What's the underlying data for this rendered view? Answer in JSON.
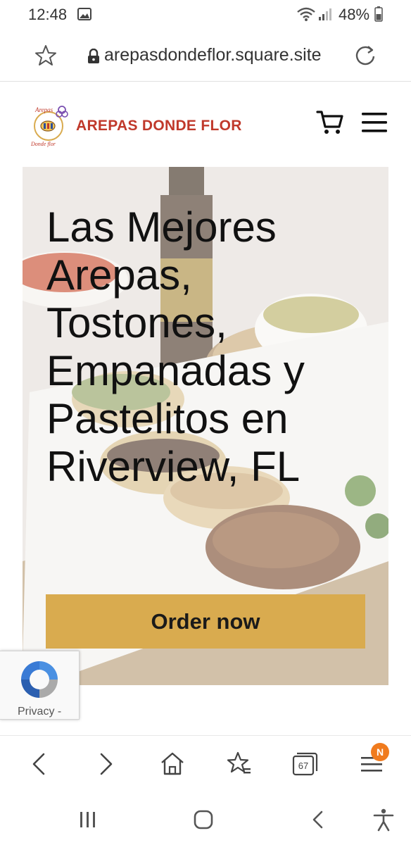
{
  "status_bar": {
    "time": "12:48",
    "battery_percent": "48%",
    "icons": [
      "image-notification-icon",
      "wifi-icon",
      "signal-icon",
      "battery-icon"
    ]
  },
  "address_bar": {
    "url": "arepasdondeflor.square.site",
    "icons": [
      "star-icon",
      "lock-icon",
      "reload-icon"
    ]
  },
  "site_header": {
    "brand_name": "AREPAS DONDE FLOR",
    "logo_text_top": "Arepas",
    "logo_text_bottom": "Donde flor",
    "icons": [
      "cart-icon",
      "hamburger-menu-icon"
    ]
  },
  "hero": {
    "title": "Las Mejores Arepas, Tostones, Empanadas y Pastelitos en Riverview, FL",
    "cta_label": "Order now"
  },
  "recaptcha": {
    "privacy_text": "Privacy -"
  },
  "browser_toolbar": {
    "tab_count": "67",
    "notification_badge": "N",
    "icons": [
      "back-icon",
      "forward-icon",
      "home-icon",
      "bookmarks-icon",
      "tabs-icon",
      "browser-menu-icon"
    ]
  },
  "android_nav": {
    "icons": [
      "recent-apps-icon",
      "home-nav-icon",
      "back-nav-icon",
      "accessibility-icon"
    ]
  },
  "colors": {
    "brand_red": "#c0392b",
    "cta_gold": "#d9ab4f",
    "badge_orange": "#f07b1e"
  }
}
